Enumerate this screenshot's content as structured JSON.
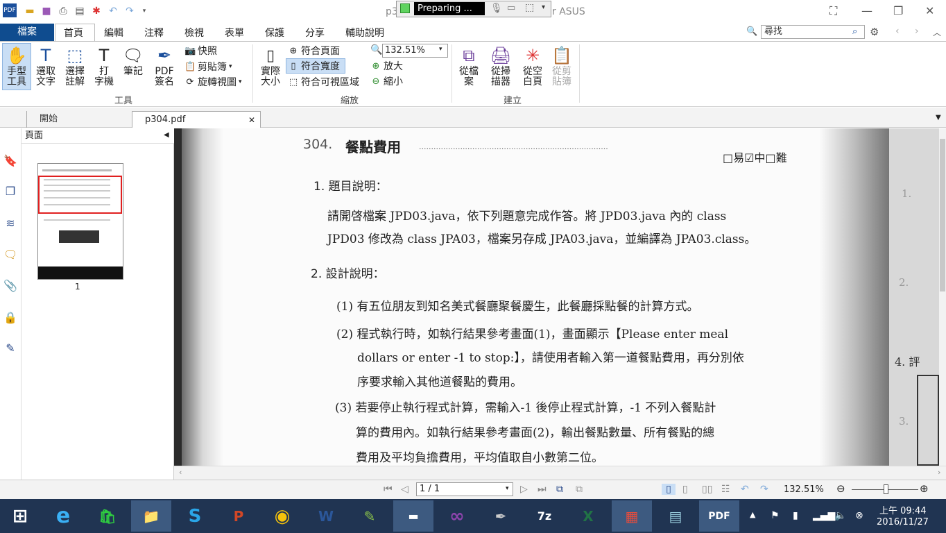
{
  "window": {
    "title_left": "p3",
    "title_right": "r ASUS",
    "recorder_status": "Preparing ..."
  },
  "quick_access_icons": [
    "app-icon",
    "open-icon",
    "save-icon",
    "print-icon",
    "properties-icon",
    "new-icon",
    "undo-icon",
    "redo-icon",
    "customize-icon"
  ],
  "menu": {
    "file": "檔案",
    "tabs": [
      "首頁",
      "編輯",
      "注釋",
      "檢視",
      "表單",
      "保護",
      "分享",
      "輔助說明"
    ]
  },
  "search": {
    "placeholder": "尋找"
  },
  "ribbon": {
    "tools": {
      "hand": "手型\n工具",
      "select_text": "選取\n文字",
      "select_annot": "選擇\n註解",
      "typewriter": "打\n字機",
      "note": "筆記",
      "pdf_sign": "PDF\n簽名",
      "snapshot": "快照",
      "clipboard": "剪貼簿",
      "rotate": "旋轉視圖",
      "group": "工具"
    },
    "zoom": {
      "actual": "實際\n大小",
      "fit_page": "符合頁面",
      "fit_width": "符合寬度",
      "fit_visible": "符合可視區域",
      "zoom_value": "132.51%",
      "zoom_in": "放大",
      "zoom_out": "縮小",
      "group": "縮放"
    },
    "create": {
      "from_file": "從檔\n案",
      "from_scanner": "從掃\n描器",
      "blank": "從空\n白頁",
      "from_clipboard": "從剪\n貼簿",
      "group": "建立"
    }
  },
  "doc_tabs": {
    "start": "開始",
    "file": "p304.pdf"
  },
  "panel": {
    "title": "頁面",
    "page_number": "1"
  },
  "document": {
    "header_num": "304.",
    "header_title": "餐點費用",
    "header_dots": "..............................................................................",
    "difficulty": "□易☑中□難",
    "s1_title": "1. 題目說明：",
    "s1_line1": "請開啓檔案 JPD03.java，依下列題意完成作答。將 JPD03.java 內的 class",
    "s1_line2": "JPD03 修改為 class JPA03，檔案另存成 JPA03.java，並編譯為 JPA03.class。",
    "s2_title": "2. 設計說明：",
    "p1": "(1) 有五位朋友到知名美式餐廳聚餐慶生，此餐廳採點餐的計算方式。",
    "p2_l1": "(2) 程式執行時，如執行結果參考畫面(1)，畫面顯示【Please  enter  meal",
    "p2_l2": "dollars or enter -1 to stop:】，請使用者輸入第一道餐點費用，再分別依",
    "p2_l3": "序要求輸入其他道餐點的費用。",
    "p3_l1": "(3) 若要停止執行程式計算，需輸入-1 後停止程式計算，-1 不列入餐點計",
    "p3_l2": "算的費用內。如執行結果參考畫面(2)，輸出餐點數量、所有餐點的總",
    "p3_l3": "費用及平均負擔費用，平均值取自小數第二位。",
    "edge_1": "1.",
    "edge_2": "2.",
    "edge_4": "4. 評",
    "edge_3": "3."
  },
  "status": {
    "page": "1 / 1",
    "zoom": "132.51%"
  },
  "taskbar": {
    "apps": [
      "start-icon",
      "ie-icon",
      "store-icon",
      "explorer-icon",
      "skype-icon",
      "powerpoint-icon",
      "chrome-icon",
      "word-icon",
      "notepadpp-icon",
      "cmd-icon",
      "visualstudio-icon",
      "quill-icon",
      "7zip-icon",
      "excel-icon",
      "office-icon",
      "notepad-icon",
      "foxit-icon"
    ],
    "time": "上午 09:44",
    "date": "2016/11/27"
  },
  "colors": {
    "file_tab": "#0f4c8f",
    "taskbar": "#203452",
    "selected": "#c9def5"
  }
}
